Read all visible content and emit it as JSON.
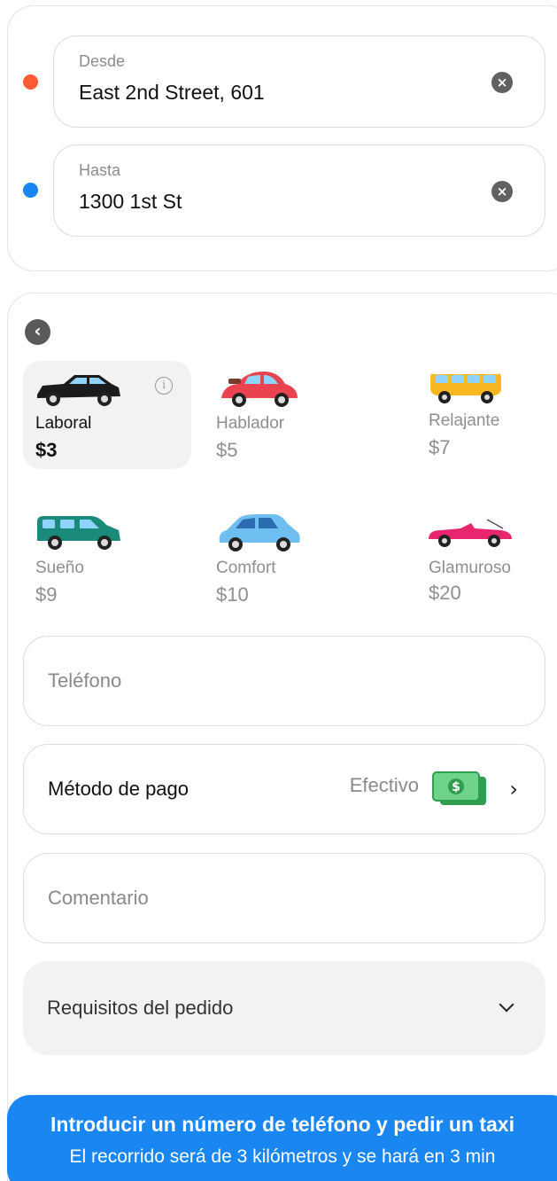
{
  "route": {
    "from": {
      "label": "Desde",
      "value": "East 2nd Street, 601",
      "dot_color": "#ff5b34"
    },
    "to": {
      "label": "Hasta",
      "value": "1300 1st St",
      "dot_color": "#1a86f2"
    }
  },
  "tariffs": [
    {
      "name": "Laboral",
      "price": "$3",
      "selected": true,
      "car_color": "#1b1b1b",
      "icon": "sedan-car-icon"
    },
    {
      "name": "Hablador",
      "price": "$5",
      "selected": false,
      "car_color": "#e8434f",
      "icon": "beetle-car-icon"
    },
    {
      "name": "Relajante",
      "price": "$7",
      "selected": false,
      "car_color": "#f7b822",
      "icon": "van-icon"
    },
    {
      "name": "Sueño",
      "price": "$9",
      "selected": false,
      "car_color": "#1c8a7a",
      "icon": "minivan-icon"
    },
    {
      "name": "Comfort",
      "price": "$10",
      "selected": false,
      "car_color": "#6fbef2",
      "icon": "hatchback-car-icon"
    },
    {
      "name": "Glamuroso",
      "price": "$20",
      "selected": false,
      "car_color": "#e8256f",
      "icon": "convertible-car-icon"
    }
  ],
  "phone": {
    "placeholder": "Teléfono"
  },
  "payment": {
    "label": "Método de pago",
    "value": "Efectivo",
    "icon": "cash-icon"
  },
  "comment": {
    "placeholder": "Comentario"
  },
  "requirements": {
    "label": "Requisitos del pedido"
  },
  "cta": {
    "title": "Introducir un número de teléfono y pedir un taxi",
    "subtitle": "El recorrido será de 3 kilómetros y se hará en 3 min"
  },
  "colors": {
    "accent": "#1a86f2",
    "from_dot": "#ff5b34",
    "to_dot": "#1a86f2"
  }
}
